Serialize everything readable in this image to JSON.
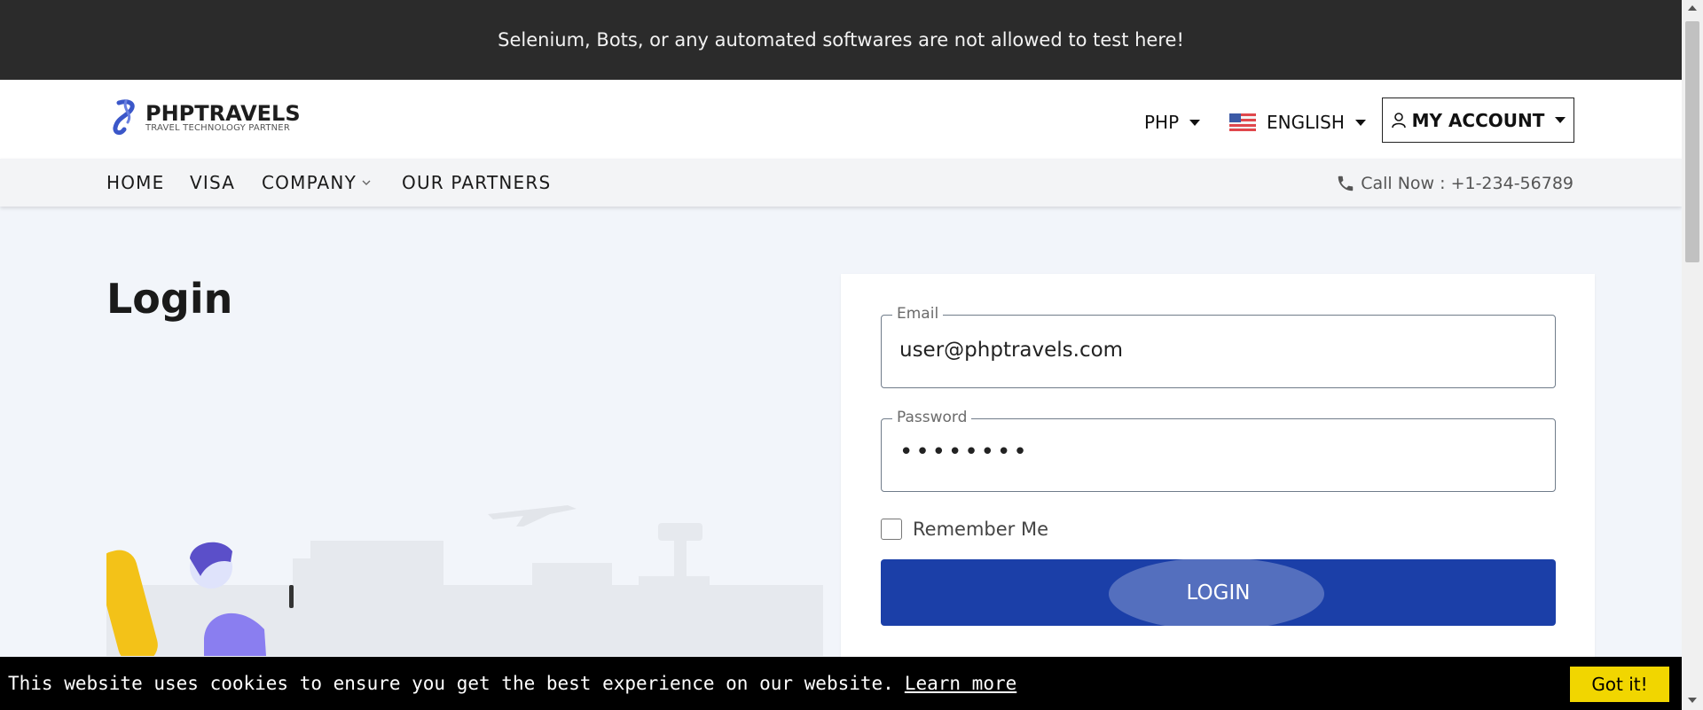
{
  "banner": {
    "text": "Selenium, Bots, or any automated softwares are not allowed to test here!"
  },
  "header": {
    "logo_name": "PHPTRAVELS",
    "logo_tagline": "TRAVEL TECHNOLOGY PARTNER",
    "currency": "PHP",
    "language": "ENGLISH",
    "account": "MY ACCOUNT"
  },
  "nav": {
    "items": [
      {
        "label": "HOME"
      },
      {
        "label": "VISA"
      },
      {
        "label": "COMPANY"
      },
      {
        "label": "OUR PARTNERS"
      }
    ],
    "call": "Call Now : +1-234-56789"
  },
  "page": {
    "title": "Login"
  },
  "form": {
    "email_label": "Email",
    "email_value": "user@phptravels.com",
    "password_label": "Password",
    "password_value": "••••••••",
    "remember_label": "Remember Me",
    "login_label": "LOGIN"
  },
  "cookie": {
    "text": "This website uses cookies to ensure you get the best experience on our website.",
    "learn_more": "Learn more",
    "got_it": "Got it!"
  },
  "colors": {
    "banner_bg": "#2b2b2b",
    "login_button": "#1b3fa8",
    "cookie_button": "#f1d600",
    "page_bg": "#f2f5fa"
  },
  "icons": [
    "logo-mark-icon",
    "caret-down-icon",
    "us-flag-icon",
    "user-icon",
    "chevron-down-icon",
    "phone-icon"
  ]
}
